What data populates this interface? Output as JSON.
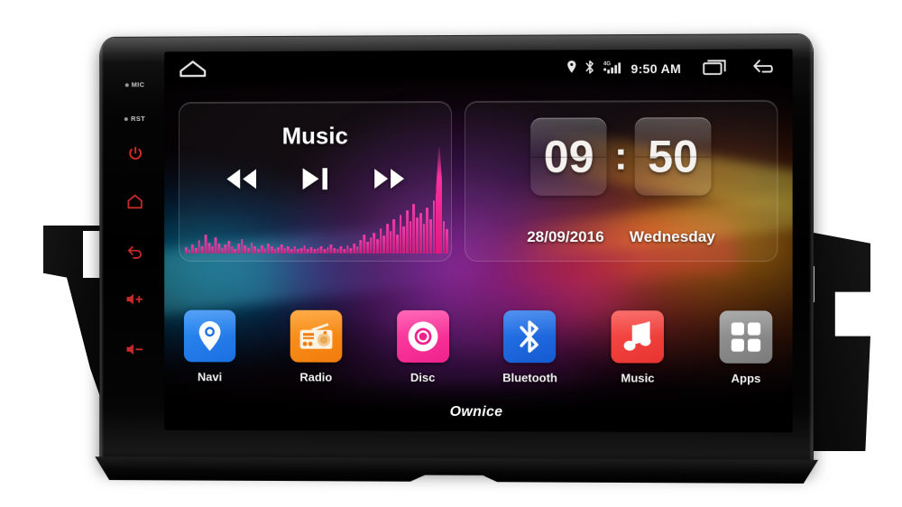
{
  "device": {
    "brand": "Ownice",
    "hardkeys": [
      {
        "name": "mic-indicator",
        "label": "MIC",
        "type": "led"
      },
      {
        "name": "reset-indicator",
        "label": "RST",
        "type": "led"
      },
      {
        "name": "power-key",
        "label": "Power",
        "icon": "power-icon"
      },
      {
        "name": "home-key",
        "label": "Home",
        "icon": "home-icon"
      },
      {
        "name": "back-key",
        "label": "Back",
        "icon": "back-arrow-icon"
      },
      {
        "name": "volume-up-key",
        "label": "Volume Up",
        "icon": "volume-up-icon"
      },
      {
        "name": "volume-down-key",
        "label": "Volume Down",
        "icon": "volume-down-icon"
      }
    ],
    "accent_red": "#d92b2b"
  },
  "statusbar": {
    "home_icon": "home-pentagon-icon",
    "icons": [
      {
        "name": "location-icon",
        "label": "Location"
      },
      {
        "name": "bluetooth-icon",
        "label": "Bluetooth"
      },
      {
        "name": "signal-4g-icon",
        "label": "4G"
      }
    ],
    "clock": "9:50 AM",
    "nav": [
      {
        "name": "recents-icon",
        "label": "Recent apps"
      },
      {
        "name": "back-icon",
        "label": "Back"
      }
    ]
  },
  "music_widget": {
    "title": "Music",
    "controls": [
      {
        "name": "previous-track-button",
        "label": "Previous"
      },
      {
        "name": "play-pause-button",
        "label": "Play / Pause"
      },
      {
        "name": "next-track-button",
        "label": "Next"
      }
    ],
    "equalizer_levels": [
      10,
      6,
      14,
      9,
      22,
      12,
      30,
      18,
      11,
      26,
      16,
      9,
      14,
      20,
      11,
      7,
      16,
      24,
      13,
      9,
      18,
      11,
      7,
      13,
      9,
      16,
      11,
      7,
      10,
      14,
      9,
      12,
      8,
      11,
      7,
      9,
      13,
      8,
      10,
      7,
      9,
      12,
      8,
      10,
      14,
      9,
      7,
      11,
      8,
      13,
      9,
      16,
      11,
      22,
      30,
      19,
      26,
      34,
      23,
      41,
      29,
      48,
      36,
      55,
      30,
      62,
      44,
      70,
      52,
      80,
      58,
      66,
      48,
      74,
      56,
      86,
      96,
      64,
      52,
      40
    ],
    "spire_color": "#ff2f9f"
  },
  "clock_widget": {
    "hours": "09",
    "separator": ":",
    "minutes": "50",
    "date": "28/09/2016",
    "weekday": "Wednesday"
  },
  "dock": {
    "apps": [
      {
        "name": "app-navi",
        "label": "Navi",
        "icon": "map-pin-icon",
        "color": "#1b6fe0",
        "color2": "#2f8ef5"
      },
      {
        "name": "app-radio",
        "label": "Radio",
        "icon": "radio-icon",
        "color": "#f07b0d",
        "color2": "#ff9a21"
      },
      {
        "name": "app-disc",
        "label": "Disc",
        "icon": "disc-icon",
        "color": "#f0218c",
        "color2": "#ff48a8"
      },
      {
        "name": "app-bluetooth",
        "label": "Bluetooth",
        "icon": "bluetooth-icon",
        "color": "#1559cf",
        "color2": "#2a7bef"
      },
      {
        "name": "app-music",
        "label": "Music",
        "icon": "music-note-icon",
        "color": "#e8332f",
        "color2": "#f9504c"
      },
      {
        "name": "app-apps",
        "label": "Apps",
        "icon": "grid-squares-icon",
        "color": "#7b7b7b",
        "color2": "#9a9a9a"
      }
    ]
  }
}
